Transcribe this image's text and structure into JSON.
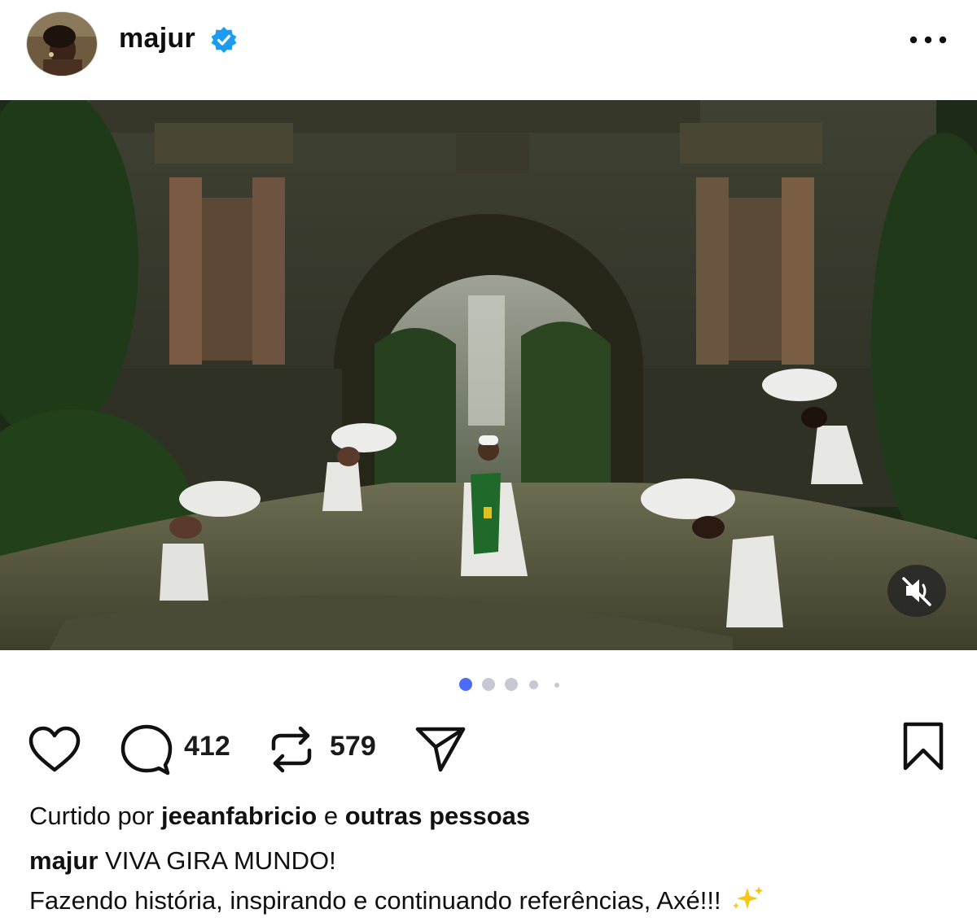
{
  "post": {
    "username": "majur",
    "verified": true,
    "more_icon": "more-horizontal-icon"
  },
  "media": {
    "type": "video",
    "mute_icon": "muted-speaker-icon",
    "carousel": {
      "count": 5,
      "active_index": 0
    }
  },
  "actions": {
    "like_icon": "heart-icon",
    "comment_icon": "comment-bubble-icon",
    "comment_count": "412",
    "repost_icon": "repost-arrows-icon",
    "repost_count": "579",
    "share_icon": "send-paper-plane-icon",
    "save_icon": "bookmark-icon"
  },
  "likes": {
    "prefix": "Curtido por",
    "user": "jeeanfabricio",
    "joiner": "e",
    "others": "outras pessoas"
  },
  "caption": {
    "username": "majur",
    "line1": "VIVA GIRA MUNDO!",
    "line2": "Fazendo história, inspirando e continuando referências, Axé!!!",
    "emoji": "sparkles-icon"
  },
  "colors": {
    "verified_blue": "#1d9bf0",
    "active_dot": "#4b6bfb",
    "inactive_dot": "#c8c8d2",
    "text": "#111111"
  }
}
